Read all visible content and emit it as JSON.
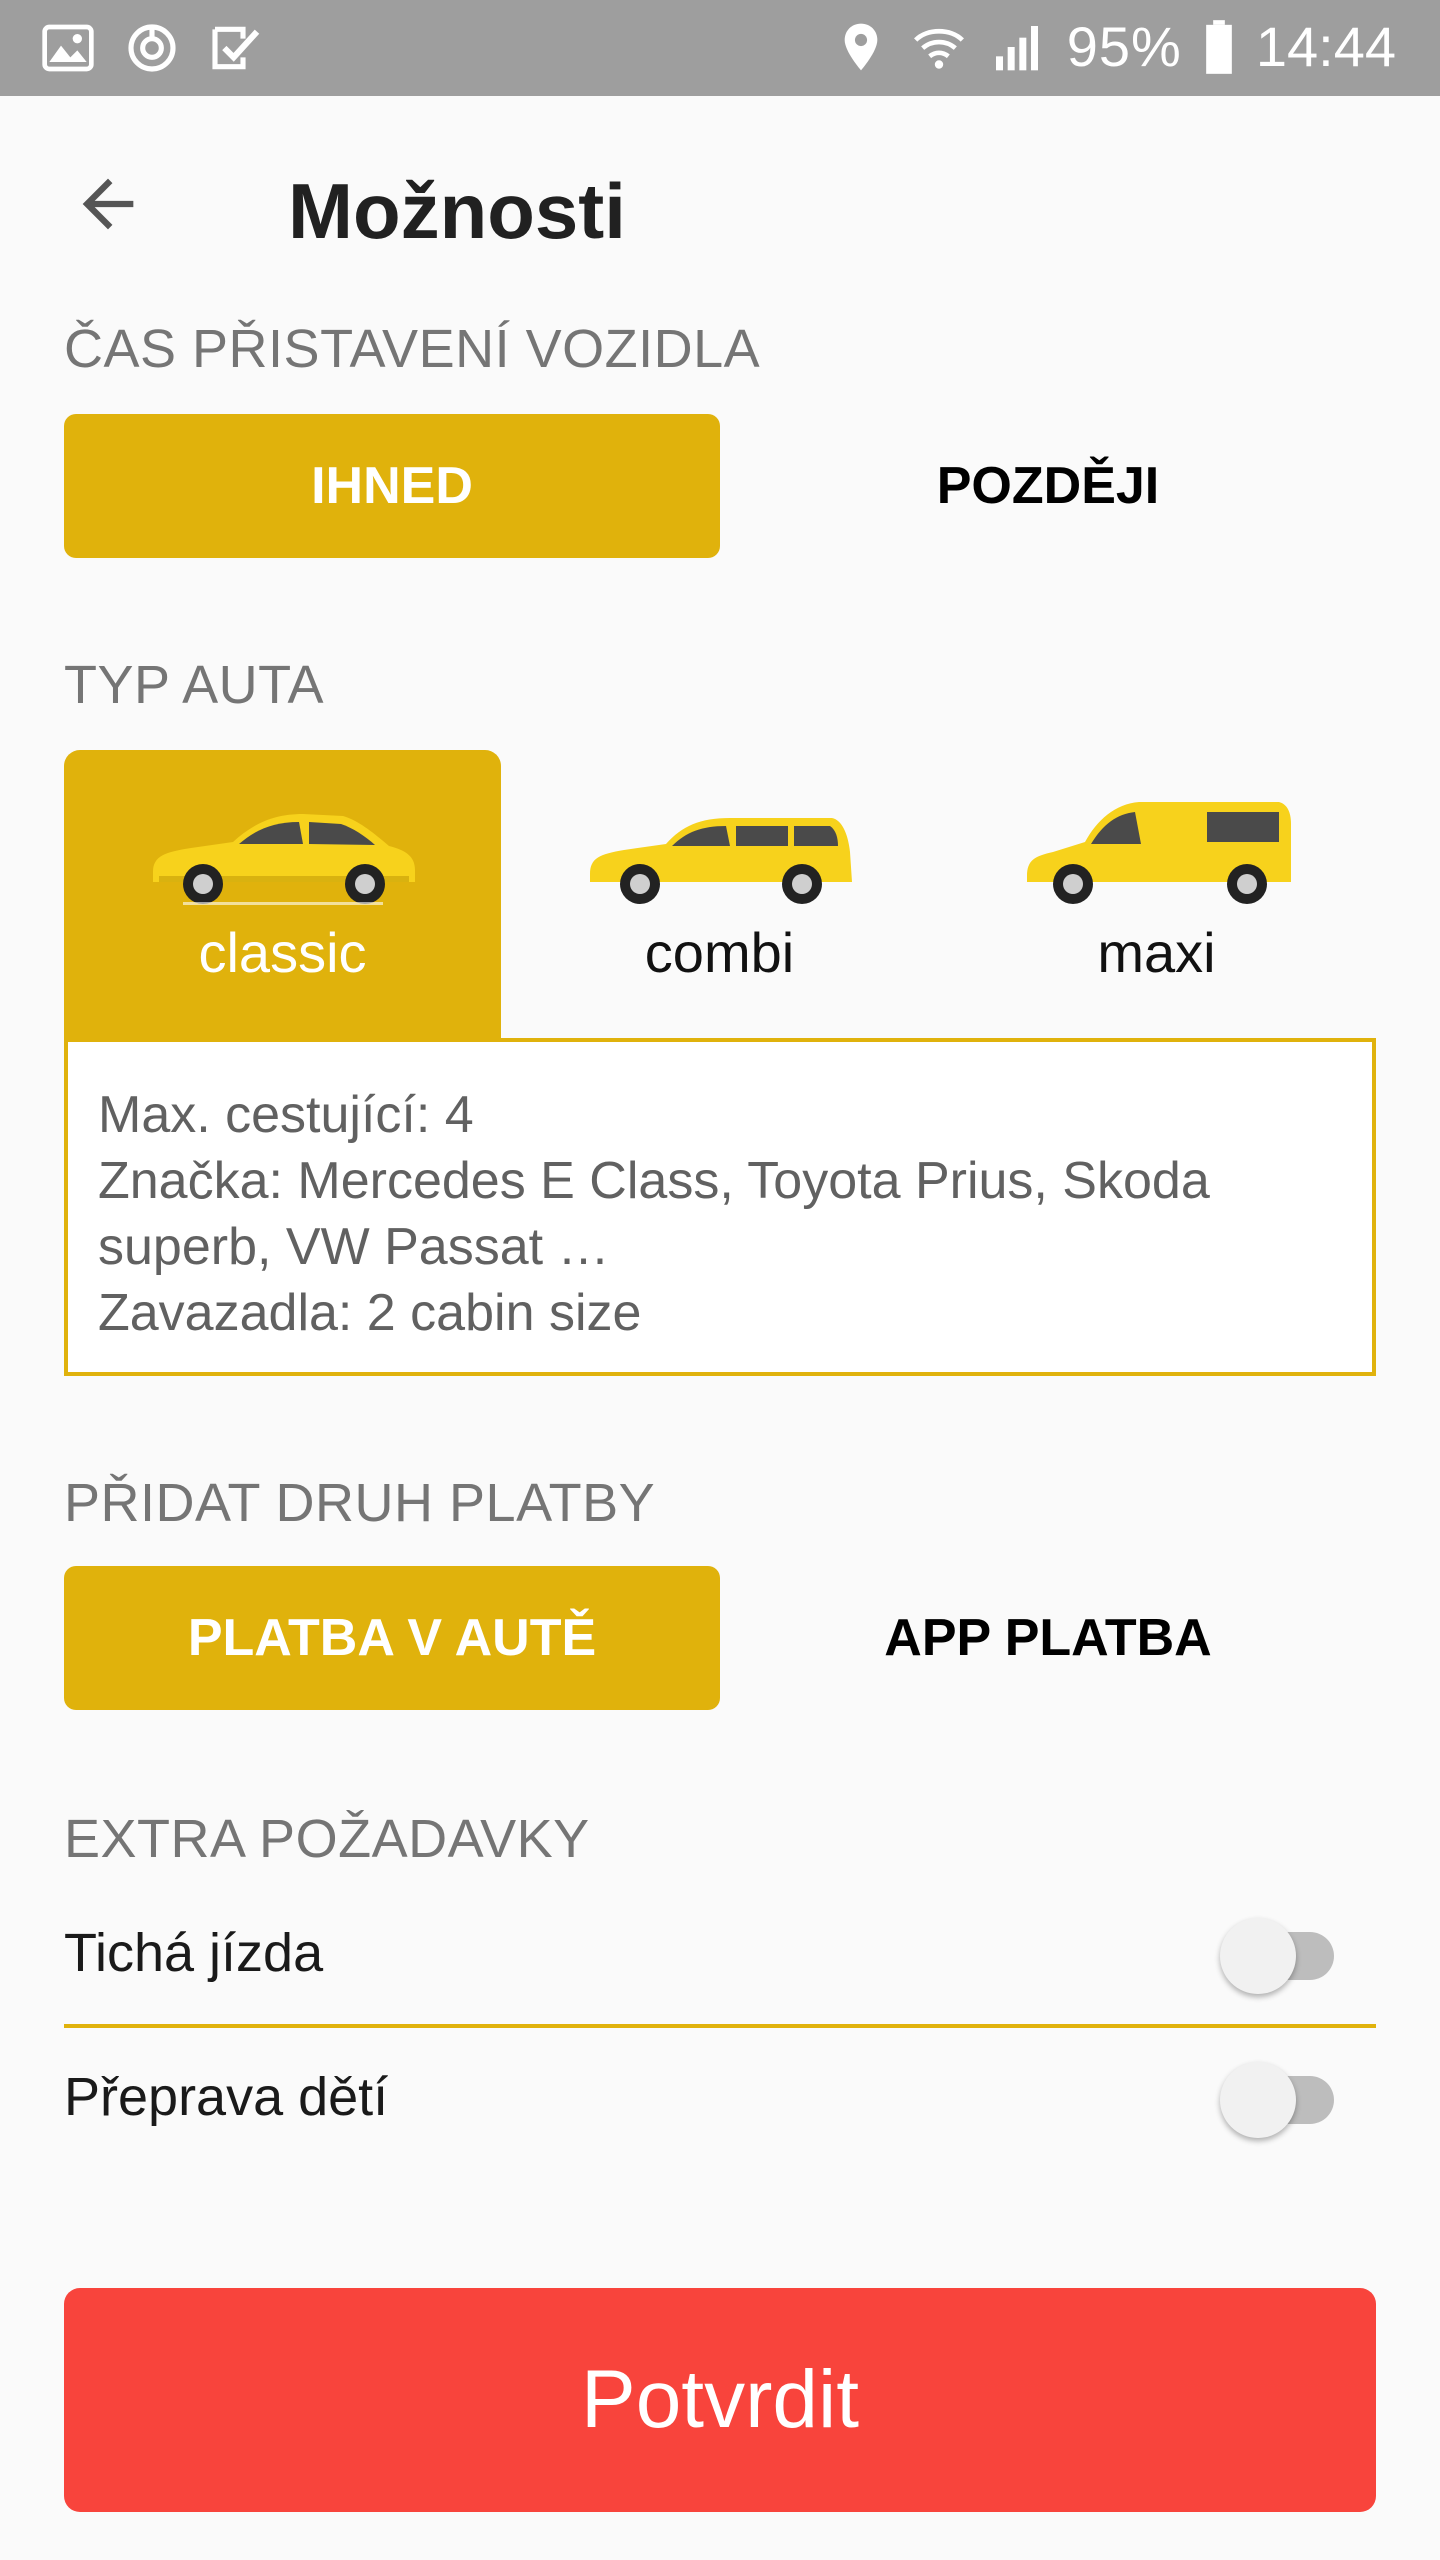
{
  "status_bar": {
    "battery": "95%",
    "time": "14:44",
    "left_icons": [
      "image-icon",
      "sync-icon",
      "check-box-icon"
    ],
    "right_icons": [
      "location-icon",
      "wifi-icon",
      "signal-icon",
      "battery-icon"
    ]
  },
  "header": {
    "title": "Možnosti",
    "back_icon": "arrow-back-icon"
  },
  "pickup_time": {
    "label": "ČAS PŘISTAVENÍ VOZIDLA",
    "options": [
      "IHNED",
      "POZDĚJI"
    ],
    "selected": "IHNED"
  },
  "car_type": {
    "label": "TYP AUTA",
    "options": [
      {
        "name": "classic",
        "icon": "sedan-car-icon"
      },
      {
        "name": "combi",
        "icon": "wagon-car-icon"
      },
      {
        "name": "maxi",
        "icon": "van-car-icon"
      }
    ],
    "selected": "classic",
    "description": {
      "line1": "Max. cestující: 4",
      "line2": "Značka: Mercedes E Class, Toyota Prius, Skoda",
      "line3": "superb, VW Passat …",
      "line4": "Zavazadla: 2 cabin size"
    }
  },
  "payment": {
    "label": "PŘIDAT DRUH PLATBY",
    "options": [
      "PLATBA V AUTĚ",
      "APP PLATBA"
    ],
    "selected": "PLATBA V AUTĚ"
  },
  "extras": {
    "label": "EXTRA POŽADAVKY",
    "items": [
      {
        "label": "Tichá jízda",
        "enabled": false
      },
      {
        "label": "Přeprava dětí",
        "enabled": false
      }
    ]
  },
  "confirm": {
    "label": "Potvrdit"
  },
  "colors": {
    "accent": "#e0b20c",
    "confirm": "#f8443c",
    "status_bar": "#9e9e9e",
    "car_yellow": "#f7d21c"
  }
}
